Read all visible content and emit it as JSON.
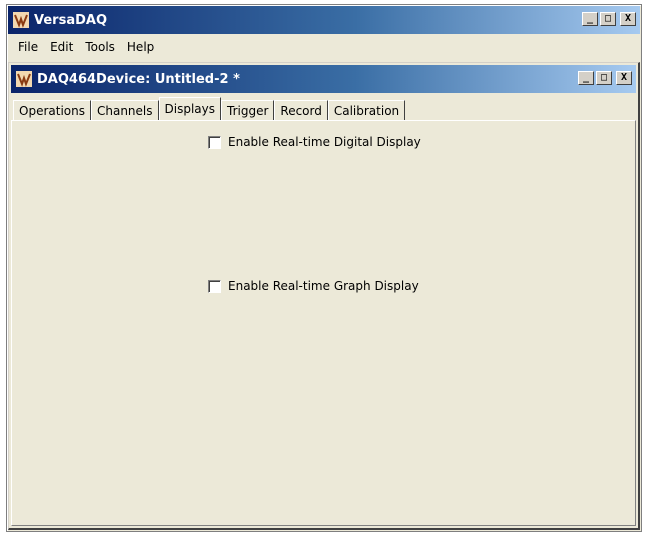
{
  "app": {
    "title": "VersaDAQ",
    "icon": "versadaq-app-icon",
    "controls": {
      "minimize": "_",
      "maximize": "□",
      "close": "X"
    }
  },
  "menu": {
    "items": [
      {
        "label": "File"
      },
      {
        "label": "Edit"
      },
      {
        "label": "Tools"
      },
      {
        "label": "Help"
      }
    ]
  },
  "child_window": {
    "title": "DAQ464Device: Untitled-2 *",
    "icon": "versadaq-document-icon",
    "controls": {
      "minimize": "_",
      "maximize": "□",
      "close": "X"
    }
  },
  "tabs": {
    "items": [
      {
        "label": "Operations",
        "active": false
      },
      {
        "label": "Channels",
        "active": false
      },
      {
        "label": "Displays",
        "active": true
      },
      {
        "label": "Trigger",
        "active": false
      },
      {
        "label": "Record",
        "active": false
      },
      {
        "label": "Calibration",
        "active": false
      }
    ]
  },
  "displays": {
    "digital": {
      "label": "Enable Real-time Digital Display",
      "checked": false
    },
    "graph": {
      "label": "Enable Real-time Graph Display",
      "checked": false
    }
  },
  "colors": {
    "titlebar_start": "#0a246a",
    "titlebar_end": "#a6caf0",
    "window_bg": "#ece9d8"
  }
}
